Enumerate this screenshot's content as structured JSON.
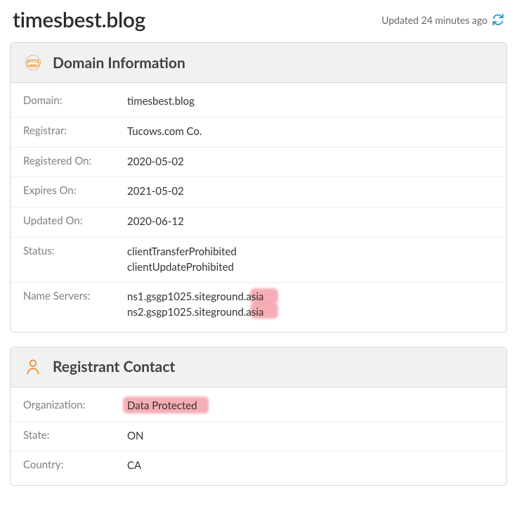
{
  "header": {
    "title": "timesbest.blog",
    "updated_text": "Updated 24 minutes ago"
  },
  "domain_info": {
    "section_title": "Domain Information",
    "rows": {
      "domain": {
        "label": "Domain:",
        "value": "timesbest.blog"
      },
      "registrar": {
        "label": "Registrar:",
        "value": "Tucows.com Co."
      },
      "registered_on": {
        "label": "Registered On:",
        "value": "2020-05-02"
      },
      "expires_on": {
        "label": "Expires On:",
        "value": "2021-05-02"
      },
      "updated_on": {
        "label": "Updated On:",
        "value": "2020-06-12"
      },
      "status": {
        "label": "Status:",
        "value1": "clientTransferProhibited",
        "value2": "clientUpdateProhibited"
      },
      "name_servers": {
        "label": "Name Servers:",
        "value1": "ns1.gsgp1025.siteground.asia",
        "value2": "ns2.gsgp1025.siteground.asia"
      }
    }
  },
  "registrant": {
    "section_title": "Registrant Contact",
    "rows": {
      "organization": {
        "label": "Organization:",
        "value": "Data Protected"
      },
      "state": {
        "label": "State:",
        "value": "ON"
      },
      "country": {
        "label": "Country:",
        "value": "CA"
      }
    }
  }
}
